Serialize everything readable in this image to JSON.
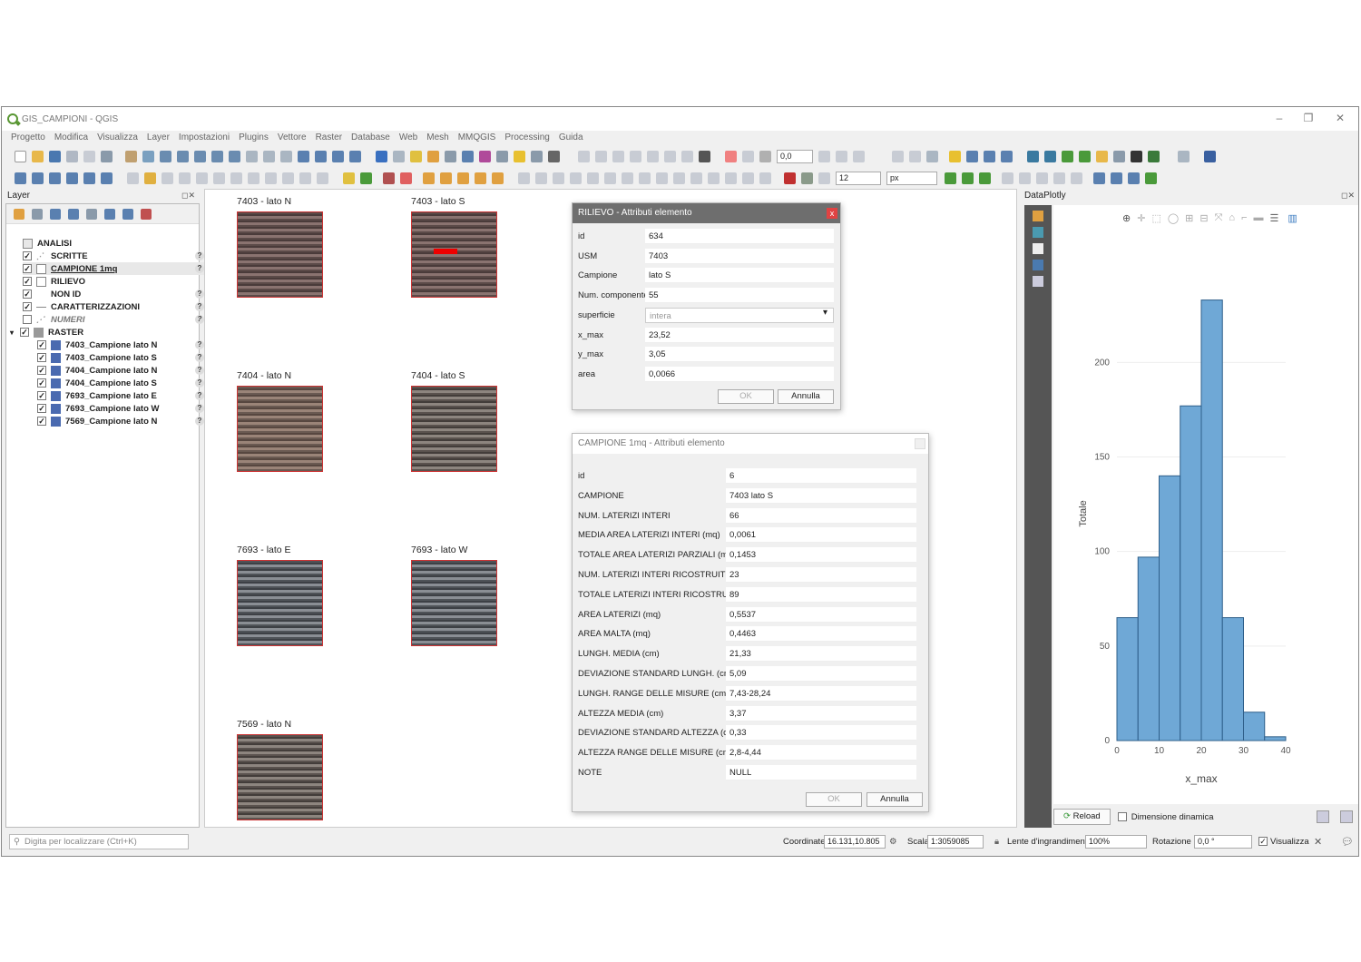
{
  "window": {
    "title": "GIS_CAMPIONI - QGIS"
  },
  "menu": [
    "Progetto",
    "Modifica",
    "Visualizza",
    "Layer",
    "Impostazioni",
    "Plugins",
    "Vettore",
    "Raster",
    "Database",
    "Web",
    "Mesh",
    "MMQGIS",
    "Processing",
    "Guida"
  ],
  "toolbar": {
    "rotation_field": "0,0",
    "size_field": "12",
    "unit_select": "px"
  },
  "layers_panel": {
    "title": "Layer",
    "items": [
      {
        "label": "ANALISI",
        "checked": false,
        "indent": 0,
        "group": true
      },
      {
        "label": "SCRITTE",
        "checked": true,
        "indent": 1
      },
      {
        "label": "CAMPIONE 1mq",
        "checked": true,
        "indent": 1
      },
      {
        "label": "RILIEVO",
        "checked": true,
        "indent": 1
      },
      {
        "label": "NON ID",
        "checked": true,
        "indent": 1
      },
      {
        "label": "CARATTERIZZAZIONI",
        "checked": true,
        "indent": 1
      },
      {
        "label": "NUMERI",
        "checked": false,
        "indent": 1
      },
      {
        "label": "RASTER",
        "checked": true,
        "indent": 0,
        "group": true
      },
      {
        "label": "7403_Campione lato N",
        "checked": true,
        "indent": 2
      },
      {
        "label": "7403_Campione lato S",
        "checked": true,
        "indent": 2
      },
      {
        "label": "7404_Campione lato N",
        "checked": true,
        "indent": 2
      },
      {
        "label": "7404_Campione lato S",
        "checked": true,
        "indent": 2
      },
      {
        "label": "7693_Campione lato E",
        "checked": true,
        "indent": 2
      },
      {
        "label": "7693_Campione lato W",
        "checked": true,
        "indent": 2
      },
      {
        "label": "7569_Campione lato N",
        "checked": true,
        "indent": 2
      }
    ]
  },
  "canvas": {
    "samples": [
      {
        "label": "7403 - lato N"
      },
      {
        "label": "7403 - lato S"
      },
      {
        "label": "7404 - lato N"
      },
      {
        "label": "7404 - lato S"
      },
      {
        "label": "7693 - lato E"
      },
      {
        "label": "7693 - lato W"
      },
      {
        "label": "7569 - lato N"
      }
    ]
  },
  "rilievo_dialog": {
    "title": "RILIEVO - Attributi elemento",
    "fields": [
      {
        "label": "id",
        "value": "634"
      },
      {
        "label": "USM",
        "value": "7403"
      },
      {
        "label": "Campione",
        "value": "lato S"
      },
      {
        "label": "Num. componente",
        "value": "55"
      },
      {
        "label": "superficie",
        "value": "intera"
      },
      {
        "label": "x_max",
        "value": "23,52"
      },
      {
        "label": "y_max",
        "value": "3,05"
      },
      {
        "label": "area",
        "value": "0,0066"
      }
    ],
    "ok": "OK",
    "cancel": "Annulla"
  },
  "campione_dialog": {
    "title": "CAMPIONE 1mq - Attributi elemento",
    "fields": [
      {
        "label": "id",
        "value": "6"
      },
      {
        "label": "CAMPIONE",
        "value": "7403 lato S"
      },
      {
        "label": "NUM. LATERIZI INTERI",
        "value": "66"
      },
      {
        "label": "MEDIA AREA LATERIZI INTERI (mq)",
        "value": "0,0061"
      },
      {
        "label": "TOTALE AREA LATERIZI PARZIALI (mq)",
        "value": "0,1453"
      },
      {
        "label": "NUM. LATERIZI INTERI RICOSTRUITI",
        "value": "23"
      },
      {
        "label": "TOTALE LATERIZI INTERI RICOSTRUITI",
        "value": "89"
      },
      {
        "label": "AREA LATERIZI (mq)",
        "value": "0,5537"
      },
      {
        "label": "AREA MALTA (mq)",
        "value": "0,4463"
      },
      {
        "label": "LUNGH. MEDIA (cm)",
        "value": "21,33"
      },
      {
        "label": "DEVIAZIONE STANDARD LUNGH. (cm)",
        "value": "5,09"
      },
      {
        "label": "LUNGH. RANGE DELLE MISURE (cm)",
        "value": "7,43-28,24"
      },
      {
        "label": "ALTEZZA MEDIA (cm)",
        "value": "3,37"
      },
      {
        "label": "DEVIAZIONE STANDARD ALTEZZA (cm)",
        "value": "0,33"
      },
      {
        "label": "ALTEZZA RANGE DELLE MISURE (cm)",
        "value": "2,8-4,44"
      },
      {
        "label": "NOTE",
        "value": "NULL"
      }
    ],
    "ok": "OK",
    "cancel": "Annulla"
  },
  "dataplotly": {
    "title": "DataPlotly",
    "reload_label": "Reload",
    "dynamic_label": "Dimensione dinamica"
  },
  "chart_data": {
    "type": "bar",
    "title": "",
    "xlabel": "x_max",
    "ylabel": "Totale",
    "bins": [
      0,
      5,
      10,
      15,
      20,
      25,
      30,
      35,
      40
    ],
    "values": [
      65,
      97,
      140,
      177,
      233,
      65,
      15,
      2
    ],
    "xlim": [
      0,
      40
    ],
    "ylim": [
      0,
      240
    ],
    "xticks": [
      "0",
      "10",
      "20",
      "30",
      "40"
    ],
    "yticks": [
      "0",
      "50",
      "100",
      "150",
      "200"
    ],
    "color": "#6fa8d6"
  },
  "status": {
    "locator_placeholder": "Digita per localizzare (Ctrl+K)",
    "coord_label": "Coordinate",
    "coord_value": "16.131,10.805",
    "scale_label": "Scala",
    "scale_value": "1:3059085",
    "magnifier_label": "Lente d'ingrandimento",
    "magnifier_value": "100%",
    "rotation_label": "Rotazione",
    "rotation_value": "0,0 °",
    "render_label": "Visualizza"
  }
}
